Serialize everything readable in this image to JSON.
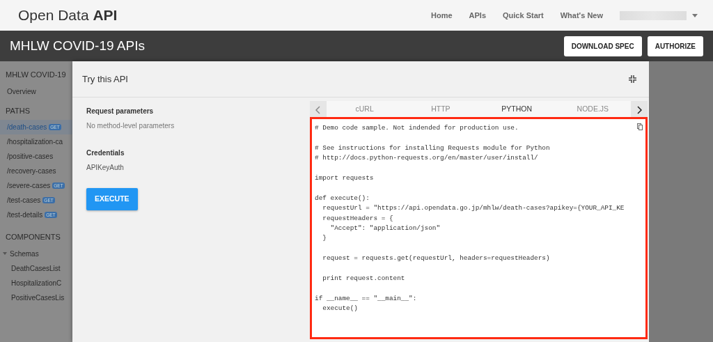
{
  "navbar": {
    "brand_light": "Open Data",
    "brand_bold": "API",
    "links": [
      {
        "label": "Home"
      },
      {
        "label": "APIs"
      },
      {
        "label": "Quick Start"
      },
      {
        "label": "What's New"
      }
    ]
  },
  "header": {
    "title": "MHLW COVID-19 APIs",
    "buttons": [
      "DOWNLOAD SPEC",
      "AUTHORIZE"
    ]
  },
  "sidebar": {
    "title": "MHLW COVID-19",
    "overview": "Overview",
    "paths_heading": "PATHS",
    "paths": [
      {
        "label": "/death-cases",
        "badge": "GET",
        "selected": true
      },
      {
        "label": "/hospitalization-ca",
        "selected": false
      },
      {
        "label": "/positive-cases",
        "selected": false
      },
      {
        "label": "/recovery-cases",
        "selected": false
      },
      {
        "label": "/severe-cases",
        "badge": "GET",
        "selected": false
      },
      {
        "label": "/test-cases",
        "badge": "GET",
        "selected": false
      },
      {
        "label": "/test-details",
        "badge": "GET",
        "selected": false
      }
    ],
    "components_heading": "COMPONENTS",
    "group": {
      "label": "Schemas",
      "expanded": true,
      "children": [
        {
          "label": "DeathCasesList"
        },
        {
          "label": "HospitalizationC"
        },
        {
          "label": "PositiveCasesLis"
        }
      ]
    }
  },
  "modal": {
    "title": "Try this API",
    "request_label": "Request parameters",
    "request_value": "No method-level parameters",
    "credentials_label": "Credentials",
    "credentials_value": "APIKeyAuth",
    "execute": "EXECUTE",
    "tabs": [
      {
        "label": "cURL",
        "selected": false
      },
      {
        "label": "HTTP",
        "selected": false
      },
      {
        "label": "PYTHON",
        "selected": true
      },
      {
        "label": "NODE.JS",
        "selected": false
      }
    ],
    "code": "# Demo code sample. Not indended for production use.\n\n# See instructions for installing Requests module for Python\n# http://docs.python-requests.org/en/master/user/install/\n\nimport requests\n\ndef execute():\n  requestUrl = \"https://api.opendata.go.jp/mhlw/death-cases?apikey={YOUR_API_KE\n  requestHeaders = {\n    \"Accept\": \"application/json\"\n  }\n\n  request = requests.get(requestUrl, headers=requestHeaders)\n\n  print request.content\n\nif __name__ == \"__main__\":\n  execute()"
  }
}
